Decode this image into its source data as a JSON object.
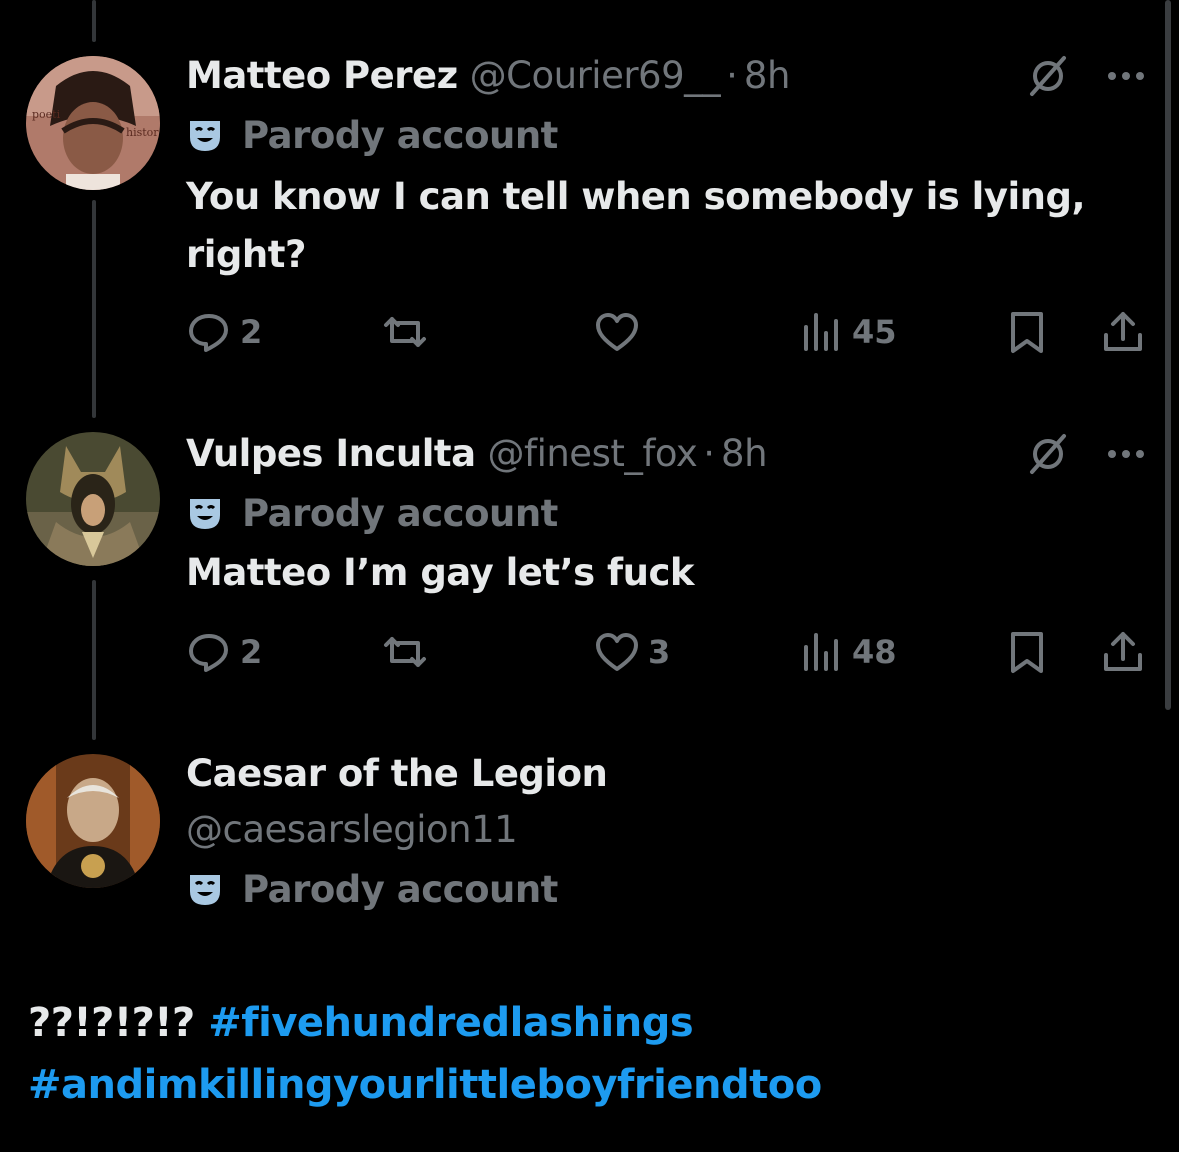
{
  "tweets": [
    {
      "name": "Matteo Perez",
      "handle": "@Courier69__",
      "dot": "·",
      "time": "8h",
      "parody": "Parody account",
      "text": "You know I can tell when somebody is lying, right?",
      "replies": "2",
      "reposts": "",
      "likes": "",
      "views": "45"
    },
    {
      "name": "Vulpes Inculta",
      "handle": "@finest_fox",
      "dot": "·",
      "time": "8h",
      "parody": "Parody account",
      "text": "Matteo I’m gay let’s fuck",
      "replies": "2",
      "reposts": "",
      "likes": "3",
      "views": "48"
    }
  ],
  "reply": {
    "name": "Caesar of the Legion",
    "handle": "@caesarslegion11",
    "parody": "Parody account",
    "text_prefix": "??!?!?!?",
    "hashtag1": "#fivehundredlashings",
    "hashtag2": "#andimkillingyourlittleboyfriendtoo"
  },
  "colors": {
    "background": "#000000",
    "primary_text": "#e7e9ea",
    "secondary_text": "#71767b",
    "accent": "#1d9bf0",
    "parody_icon": "#a9c8e2"
  },
  "icons": {
    "reply": "reply-icon",
    "repost": "repost-icon",
    "like": "heart-icon",
    "views": "views-icon",
    "bookmark": "bookmark-icon",
    "share": "share-icon",
    "grok": "grok-icon",
    "more": "more-icon",
    "parody": "parody-mask-icon"
  }
}
